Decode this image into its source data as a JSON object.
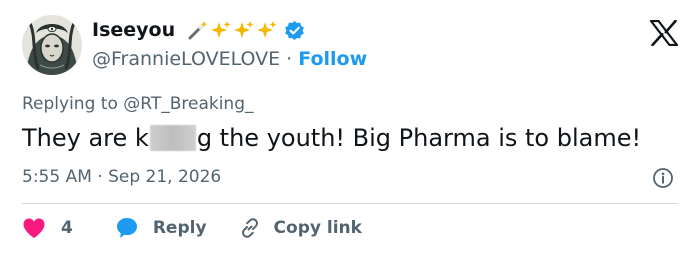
{
  "user": {
    "display_name": "Iseeyou",
    "handle": "@FrannieLOVELOVE",
    "separator": " · ",
    "follow_label": "Follow",
    "verified": true
  },
  "tweet": {
    "replying_prefix": "Replying to ",
    "replying_to": "@RT_Breaking_",
    "text_before_censor": "They are k",
    "text_after_censor": "g the youth! Big Pharma is to blame!",
    "timestamp": "5:55 AM · Sep 21, 2026"
  },
  "actions": {
    "like_count": "4",
    "reply_label": "Reply",
    "copy_link_label": "Copy link"
  },
  "icons": {
    "emoji": [
      "magic-wand-icon",
      "sparkles-icon",
      "sparkles-icon",
      "sparkles-icon"
    ],
    "verified": "verified-badge-icon",
    "logo": "x-logo-icon",
    "info": "info-icon",
    "like": "heart-icon",
    "reply": "speech-bubble-icon",
    "copy": "link-icon"
  },
  "colors": {
    "accent": "#1d9bf0",
    "heart": "#f91880",
    "text": "#0f1419",
    "secondary": "#536471",
    "divider": "#cfd9de",
    "sparkle": "#f5b800"
  }
}
